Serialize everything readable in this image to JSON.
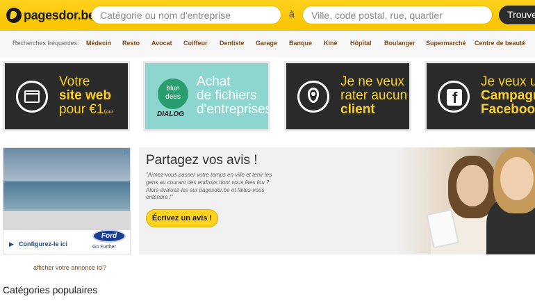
{
  "header": {
    "logo_text": "pagesdor.be",
    "search_category_placeholder": "Catégorie ou nom d'entreprise",
    "separator": "à",
    "search_location_placeholder": "Ville, code postal, rue, quartier",
    "find_button": "Trouver"
  },
  "frequent": {
    "label": "Recherches fréquentes:",
    "items": [
      "Médecin",
      "Resto",
      "Avocat",
      "Coiffeur",
      "Dentiste",
      "Garage",
      "Banque",
      "Kiné",
      "Hôpital",
      "Boulanger",
      "Supermarché",
      "Centre de beauté"
    ]
  },
  "tiles": [
    {
      "line1": "Votre",
      "line2": "site web",
      "line3": "pour €1",
      "line3b": "/jour",
      "icon": "browser-icon"
    },
    {
      "brand1": "blue",
      "brand2": "dees",
      "brand3": "DIALOG",
      "line1": "Achat",
      "line2": "de fichiers",
      "line3": "d'entreprises"
    },
    {
      "line1": "Je ne veux",
      "line2": "rater aucun",
      "line3": "client",
      "icon": "map-pin-icon"
    },
    {
      "line1": "Je veux un",
      "line2": "Campagn",
      "line3": "Faceboo",
      "icon": "facebook-icon"
    }
  ],
  "ad": {
    "cta": "Configurez-le ici",
    "brand": "Ford",
    "tagline": "Go Further",
    "note": "afficher votre annonce ici?"
  },
  "review": {
    "title": "Partagez vos avis !",
    "quote": "\"Aimez-vous passer votre temps en ville et tenir les gens au courant des endroits dont vous êtes fou ? Alors évaluez-les sur pagesdor.be et faites-vous entendre !\"",
    "button": "Écrivez un avis !"
  },
  "sections": {
    "popular_title": "Catégories populaires"
  },
  "colors": {
    "brand_yellow": "#ffd21f",
    "dark_tile": "#2a2a2a",
    "teal_tile": "#8dd6cf",
    "link_brown": "#7a4a1a"
  }
}
